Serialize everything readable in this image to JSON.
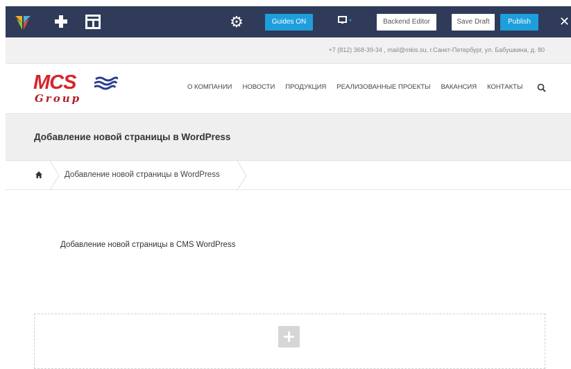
{
  "toolbar": {
    "guides_label": "Guides ON",
    "backend_label": "Backend Editor",
    "draft_label": "Save Draft",
    "publish_label": "Publish",
    "close_glyph": "✕",
    "icons": [
      "vc-logo-icon",
      "add-element-icon",
      "templates-icon",
      "settings-gear-icon",
      "device-preview-icon",
      "close-icon"
    ]
  },
  "contact": {
    "text": "+7 (812) 368-39-34 , mail@mkis.su, г.Санкт-Петербург, ул. Бабушкина, д. 80"
  },
  "header": {
    "logo_main": "MCS",
    "logo_sub": "Group",
    "nav": [
      "О КОМПАНИИ",
      "НОВОСТИ",
      "ПРОДУКЦИЯ",
      "РЕАЛИЗОВАННЫЕ ПРОЕКТЫ",
      "ВАКАНСИЯ",
      "КОНТАКТЫ"
    ]
  },
  "title_band": {
    "title": "Добавление новой страницы в WordPress"
  },
  "breadcrumb": {
    "current": "Добавление новой страницы в WordPress"
  },
  "content": {
    "text": "Добавление новой страницы в CMS WordPress"
  },
  "colors": {
    "toolbar_bg": "#2f3b59",
    "accent_blue": "#1e9fdc",
    "brand_red": "#d8242b",
    "brand_navy": "#2b3d8f"
  }
}
